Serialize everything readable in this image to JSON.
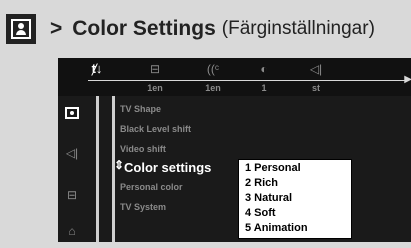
{
  "heading": {
    "arrow": ">",
    "title": "Color Settings",
    "subtitle": "(Färginställningar)"
  },
  "topbar": {
    "items": [
      {
        "icon": "setup-icon",
        "glyph": "ⱦ↓",
        "value": ""
      },
      {
        "icon": "subtitle-icon",
        "glyph": "⊟",
        "value": "1en"
      },
      {
        "icon": "audio-icon",
        "glyph": "((ᶜ",
        "value": "1en"
      },
      {
        "icon": "angle-icon",
        "glyph": "◐",
        "value": "1"
      },
      {
        "icon": "speaker-icon",
        "glyph": "◁|",
        "value": "st"
      }
    ]
  },
  "left_icons": [
    "picture-icon",
    "sound-icon",
    "language-icon",
    "features-icon"
  ],
  "menu": {
    "items": [
      "TV Shape",
      "Black Level shift",
      "Video shift",
      "Color settings",
      "Personal color",
      "TV System"
    ],
    "selected_index": 3
  },
  "options": {
    "items": [
      "1 Personal",
      "2 Rich",
      "3 Natural",
      "4 Soft",
      "5 Animation"
    ]
  }
}
